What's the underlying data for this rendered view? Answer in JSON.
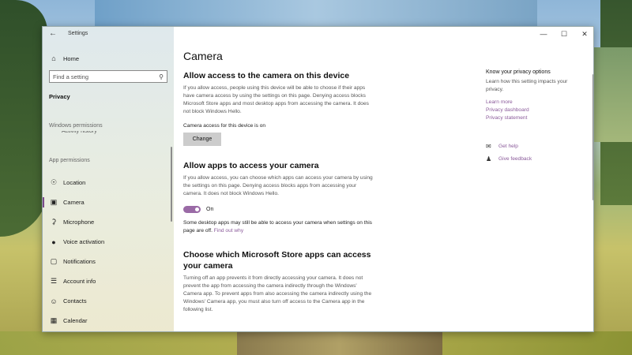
{
  "window": {
    "title": "Settings",
    "controls": {
      "minimize": "—",
      "maximize": "☐",
      "close": "✕"
    }
  },
  "sidebar": {
    "home_label": "Home",
    "search_placeholder": "Find a setting",
    "privacy_label": "Privacy",
    "windows_permissions_label": "Windows permissions",
    "partial_item_label": "Activity history",
    "app_permissions_label": "App permissions",
    "items": [
      {
        "label": "Location",
        "icon": "location-icon"
      },
      {
        "label": "Camera",
        "icon": "camera-icon",
        "selected": true
      },
      {
        "label": "Microphone",
        "icon": "microphone-icon"
      },
      {
        "label": "Voice activation",
        "icon": "voice-activation-icon"
      },
      {
        "label": "Notifications",
        "icon": "notifications-icon"
      },
      {
        "label": "Account info",
        "icon": "account-info-icon"
      },
      {
        "label": "Contacts",
        "icon": "contacts-icon"
      },
      {
        "label": "Calendar",
        "icon": "calendar-icon"
      }
    ]
  },
  "main": {
    "page_title": "Camera",
    "section1": {
      "heading": "Allow access to the camera on this device",
      "description": "If you allow access, people using this device will be able to choose if their apps have camera access by using the settings on this page. Denying access blocks Microsoft Store apps and most desktop apps from accessing the camera. It does not block Windows Hello.",
      "status": "Camera access for this device is on",
      "button_label": "Change"
    },
    "section2": {
      "heading": "Allow apps to access your camera",
      "description": "If you allow access, you can choose which apps can access your camera by using the settings on this page. Denying access blocks apps from accessing your camera. It does not block Windows Hello.",
      "toggle_state": "On",
      "note": "Some desktop apps may still be able to access your camera when settings on this page are off.",
      "note_link": "Find out why"
    },
    "section3": {
      "heading": "Choose which Microsoft Store apps can access your camera",
      "description": "Turning off an app prevents it from directly accessing your camera. It does not prevent the app from accessing the camera indirectly through the Windows' Camera app. To prevent apps from also accessing the camera indirectly using the Windows' Camera app, you must also turn off access to the Camera app in the following list."
    }
  },
  "right_panel": {
    "title": "Know your privacy options",
    "description": "Learn how this setting impacts your privacy.",
    "links": [
      "Learn more",
      "Privacy dashboard",
      "Privacy statement"
    ],
    "get_help": "Get help",
    "give_feedback": "Give feedback"
  },
  "colors": {
    "accent": "#8a5a9a",
    "toggle": "#9a6aa6"
  }
}
